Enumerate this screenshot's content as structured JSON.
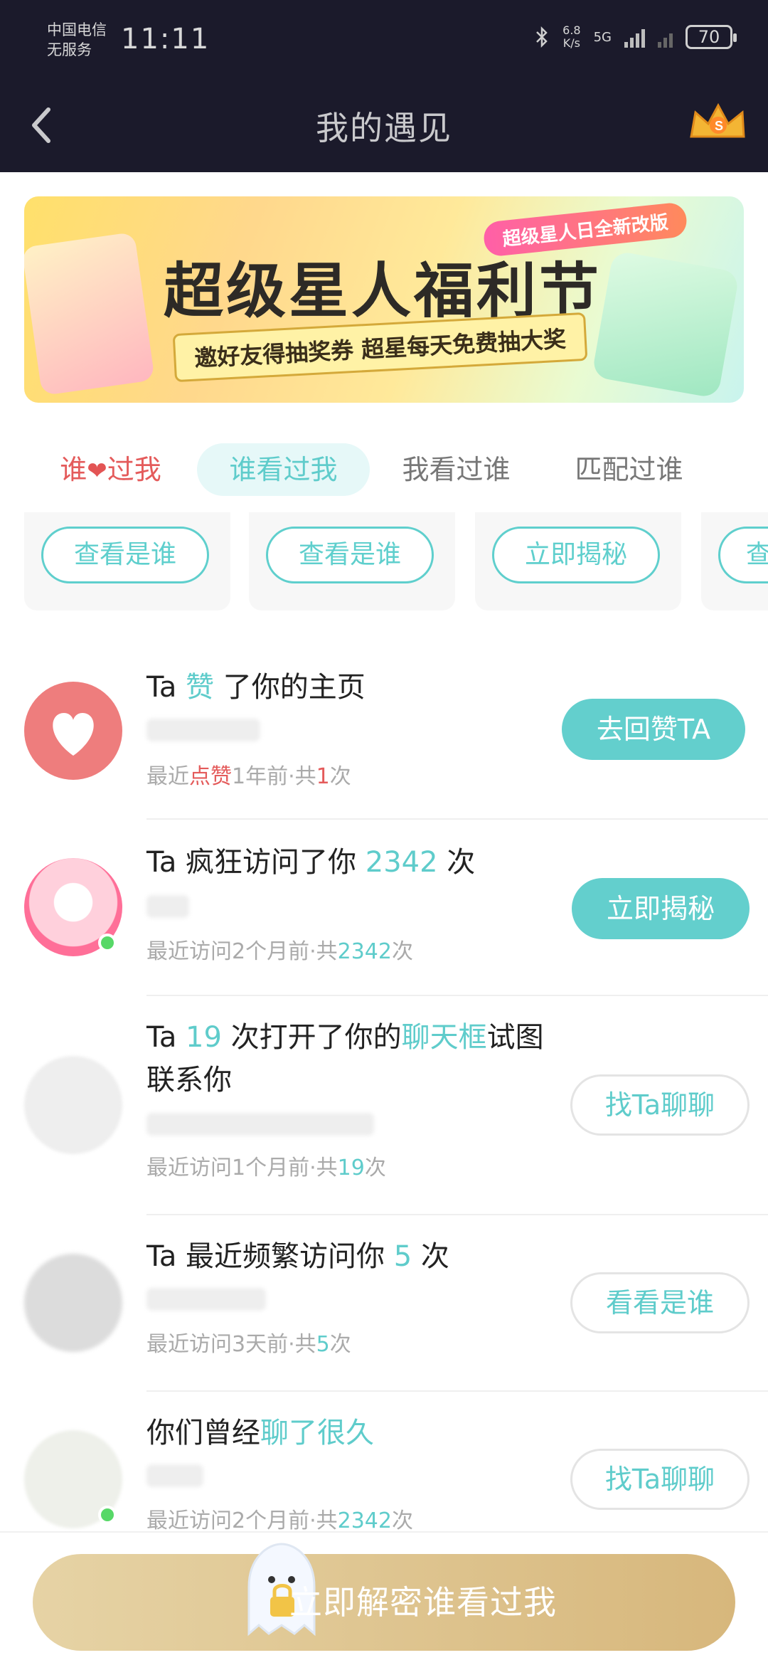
{
  "status_bar": {
    "carrier_line1": "中国电信",
    "carrier_line2": "无服务",
    "time": "11:11",
    "speed_value": "6.8",
    "speed_unit": "K/s",
    "network": "5G",
    "battery": "70"
  },
  "header": {
    "title": "我的遇见"
  },
  "banner": {
    "tag": "超级星人日全新改版",
    "title": "超级星人福利节",
    "subtitle": "邀好友得抽奖券 超星每天免费抽大奖"
  },
  "tabs": [
    {
      "label_pre": "谁",
      "label_post": "过我"
    },
    {
      "label": "谁看过我"
    },
    {
      "label": "我看过谁"
    },
    {
      "label": "匹配过谁"
    }
  ],
  "cards": [
    {
      "button": "查看是谁"
    },
    {
      "button": "查看是谁"
    },
    {
      "button": "立即揭秘"
    },
    {
      "button": "查"
    }
  ],
  "list": [
    {
      "t1": "Ta ",
      "t2": "赞",
      "t3": " 了你的主页",
      "m1": "最近",
      "m2": "点赞",
      "m3": "1年前·共",
      "m4": "1",
      "m5": "次",
      "action": "去回赞TA"
    },
    {
      "t1": "Ta 疯狂访问了你 ",
      "t2": "2342",
      "t3": " 次",
      "m1": "最近访问2个月前·共",
      "m2": "2342",
      "m3": "次",
      "action": "立即揭秘"
    },
    {
      "t1": "Ta ",
      "t2": "19",
      "t3": " 次打开了你的",
      "t4": "聊天框",
      "t5": "试图联系你",
      "m1": "最近访问1个月前·共",
      "m2": "19",
      "m3": "次",
      "action": "找Ta聊聊"
    },
    {
      "t1": "Ta 最近频繁访问你 ",
      "t2": "5",
      "t3": " 次",
      "m1": "最近访问3天前·共",
      "m2": "5",
      "m3": "次",
      "action": "看看是谁"
    },
    {
      "t1": "你们曾经",
      "t2": "聊了很久",
      "m1": "最近访问2个月前·共",
      "m2": "2342",
      "m3": "次",
      "action": "找Ta聊聊"
    }
  ],
  "bottom": {
    "button": "立即解密谁看过我"
  },
  "colors": {
    "accent": "#5fcccb",
    "header_bg": "#1b1a2b",
    "like_red": "#e45b5b",
    "gold": "#d7b77c"
  }
}
